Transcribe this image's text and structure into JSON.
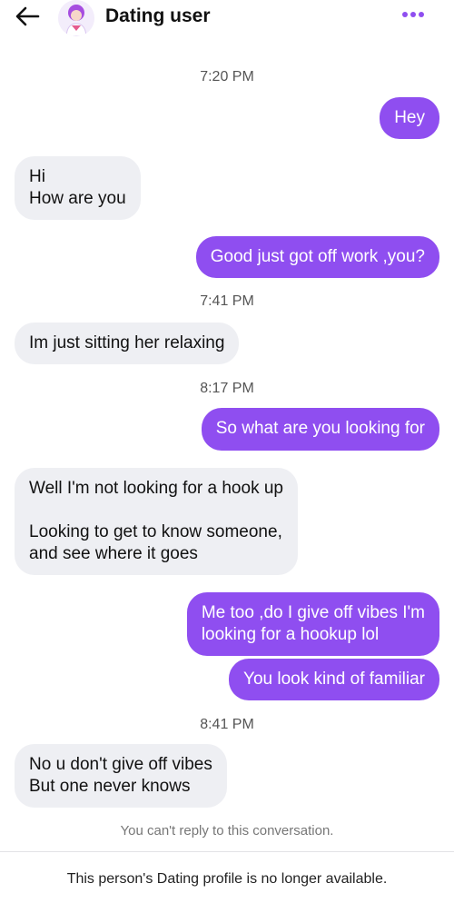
{
  "header": {
    "title": "Dating user",
    "back_icon": "arrow-left-icon",
    "more_icon": "more-horizontal-icon",
    "accent": "#8f4ef0"
  },
  "times": [
    "7:20 PM",
    "7:41 PM",
    "8:17 PM",
    "8:41 PM"
  ],
  "messages": [
    {
      "from": "me",
      "text": "Hey"
    },
    {
      "from": "them",
      "text": "Hi\nHow are you"
    },
    {
      "from": "me",
      "text": "Good just got off work ,you?"
    },
    {
      "from": "them",
      "text": "Im just sitting her relaxing"
    },
    {
      "from": "me",
      "text": "So what are you looking for"
    },
    {
      "from": "them",
      "text": "Well I'm not looking for a hook up\n\nLooking to get to know someone,\nand see where it goes"
    },
    {
      "from": "me",
      "text": "Me too ,do I give off vibes I'm\nlooking for a hookup lol"
    },
    {
      "from": "me",
      "text": "You look kind of familiar"
    },
    {
      "from": "them",
      "text": "No u don't give off vibes\nBut one never knows"
    }
  ],
  "footer": {
    "note": "You can't reply to this conversation.",
    "profile_notice": "This person's Dating profile is no longer available."
  }
}
